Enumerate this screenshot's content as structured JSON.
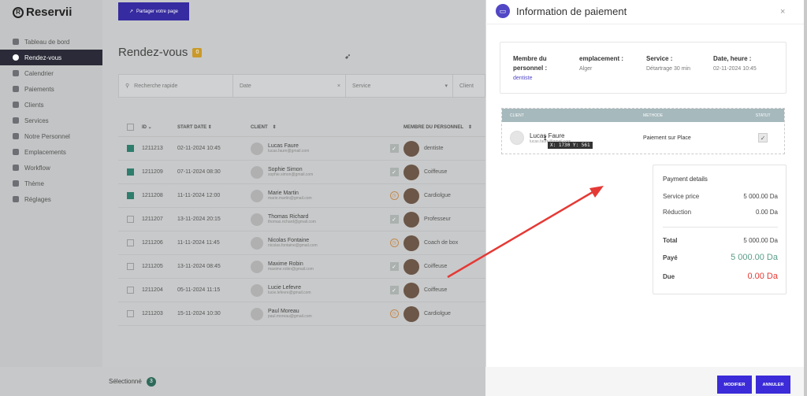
{
  "app": {
    "logo_letter": "R",
    "name": "Reservii"
  },
  "sidebar": {
    "items": [
      {
        "label": "Tableau de bord",
        "icon": "dashboard-icon"
      },
      {
        "label": "Rendez-vous",
        "icon": "clock-icon",
        "active": true
      },
      {
        "label": "Calendrier",
        "icon": "calendar-icon"
      },
      {
        "label": "Paiements",
        "icon": "payments-icon"
      },
      {
        "label": "Clients",
        "icon": "clients-icon"
      },
      {
        "label": "Services",
        "icon": "services-icon"
      },
      {
        "label": "Notre Personnel",
        "icon": "staff-icon"
      },
      {
        "label": "Emplacements",
        "icon": "location-icon"
      },
      {
        "label": "Workflow",
        "icon": "workflow-icon"
      },
      {
        "label": "Thème",
        "icon": "theme-icon"
      },
      {
        "label": "Réglages",
        "icon": "settings-icon"
      }
    ]
  },
  "header": {
    "share_label": "Partager votre page"
  },
  "main": {
    "title": "Rendez-vous",
    "title_count": "0",
    "filters": {
      "search_placeholder": "Recherche rapide",
      "date": "Date",
      "date_clear": "×",
      "service": "Service",
      "client": "Client"
    },
    "columns": {
      "id": "ID",
      "start_date": "START DATE",
      "client": "CLIENT",
      "member": "MEMBRE DU PERSONNEL"
    },
    "rows": [
      {
        "checked": true,
        "id": "1211213",
        "date": "02-11-2024 10:45",
        "name": "Lucas Faure",
        "email": "lucas.faure@gmail.com",
        "status": "check",
        "member": "dentiste"
      },
      {
        "checked": true,
        "id": "1211209",
        "date": "07-11-2024 08:30",
        "name": "Sophie Simon",
        "email": "sophie.simon@gmail.com",
        "status": "check",
        "member": "Coiffeuse"
      },
      {
        "checked": true,
        "id": "1211208",
        "date": "11-11-2024 12:00",
        "name": "Marie Martin",
        "email": "marie.martin@gmail.com",
        "status": "clock",
        "member": "Cardiolgue"
      },
      {
        "checked": false,
        "id": "1211207",
        "date": "13-11-2024 20:15",
        "name": "Thomas Richard",
        "email": "thomas.richard@gmail.com",
        "status": "check",
        "member": "Professeur"
      },
      {
        "checked": false,
        "id": "1211206",
        "date": "11-11-2024 11:45",
        "name": "Nicolas Fontaine",
        "email": "nicolas.fontaine@gmail.com",
        "status": "clock",
        "member": "Coach de box"
      },
      {
        "checked": false,
        "id": "1211205",
        "date": "13-11-2024 08:45",
        "name": "Maxime Robin",
        "email": "maxime.robin@gmail.com",
        "status": "check",
        "member": "Coiffeuse"
      },
      {
        "checked": false,
        "id": "1211204",
        "date": "05-11-2024 11:15",
        "name": "Lucie Lefevre",
        "email": "lucie.lefevre@gmail.com",
        "status": "check",
        "member": "Coiffeuse"
      },
      {
        "checked": false,
        "id": "1211203",
        "date": "15-11-2024 10:30",
        "name": "Paul Moreau",
        "email": "paul.moreau@gmail.com",
        "status": "clock",
        "member": "Cardiolgue"
      }
    ],
    "selected_label": "Sélectionné",
    "selected_count": "3"
  },
  "drawer": {
    "title": "Information de paiement",
    "close": "×",
    "info": {
      "staff_label": "Membre du personnel :",
      "staff_value": "dentiste",
      "location_label": "emplacement :",
      "location_value": "Alger",
      "service_label": "Service :",
      "service_value": "Détartrage 30 min",
      "datetime_label": "Date, heure :",
      "datetime_value": "02-11-2024 10:45"
    },
    "payments": {
      "headers": {
        "client": "CLIENT",
        "method": "METHODE",
        "status": "STATUT"
      },
      "client_name": "Lucas Faure",
      "client_email": "lucas.faure@gmail.com",
      "method": "Paiement sur Place",
      "status_mark": "✓"
    },
    "tooltip": "X: 1730 Y: 561",
    "details": {
      "title": "Payment details",
      "service_price_label": "Service price",
      "service_price_value": "5 000.00 Da",
      "reduction_label": "Réduction",
      "reduction_value": "0.00 Da",
      "total_label": "Total",
      "total_value": "5 000.00 Da",
      "paid_label": "Payé",
      "paid_value": "5 000.00 Da",
      "due_label": "Due",
      "due_value": "0.00 Da"
    },
    "buttons": {
      "modify": "MODIFIER",
      "cancel": "ANNULER"
    }
  },
  "colors": {
    "accent": "#3b2bd8",
    "paid": "#5b9c8a",
    "due": "#e53935",
    "annotation_arrow": "#e53935"
  }
}
